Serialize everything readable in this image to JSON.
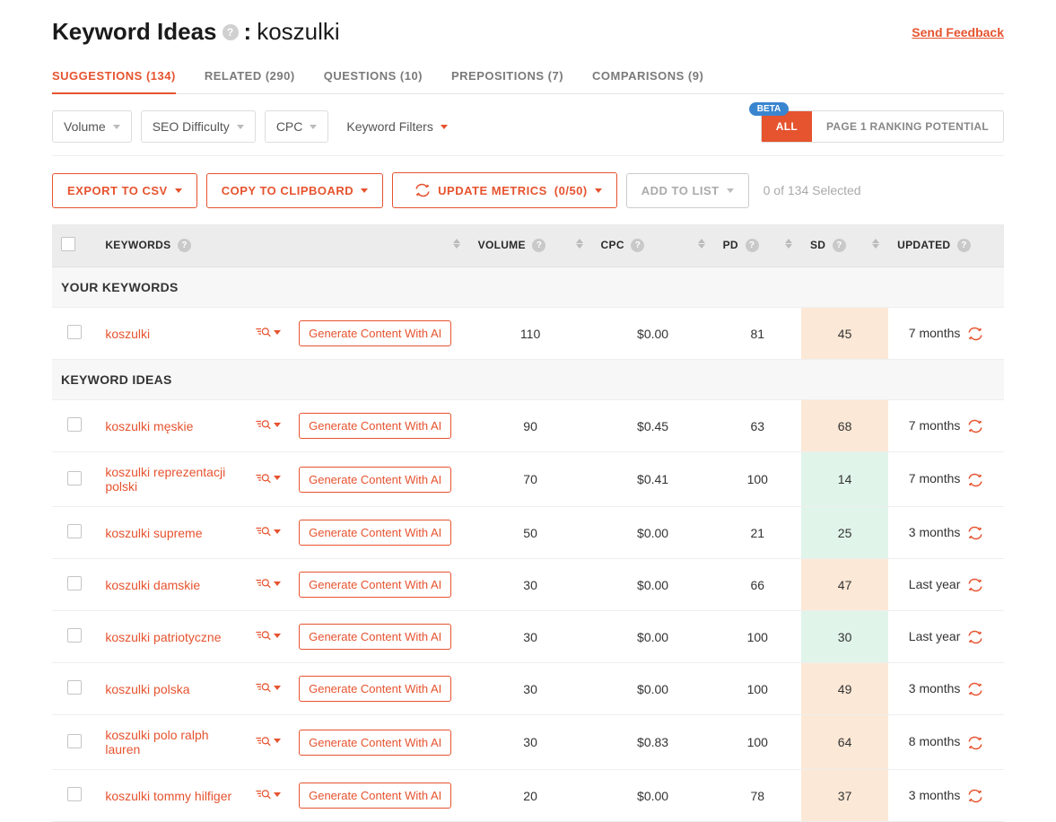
{
  "header": {
    "title_prefix": "Keyword Ideas",
    "title_sep": ":",
    "keyword": "koszulki",
    "feedback_label": "Send Feedback"
  },
  "tabs": [
    {
      "label": "SUGGESTIONS (134)",
      "active": true
    },
    {
      "label": "RELATED (290)",
      "active": false
    },
    {
      "label": "QUESTIONS (10)",
      "active": false
    },
    {
      "label": "PREPOSITIONS (7)",
      "active": false
    },
    {
      "label": "COMPARISONS (9)",
      "active": false
    }
  ],
  "filters": {
    "volume_label": "Volume",
    "seo_label": "SEO Difficulty",
    "cpc_label": "CPC",
    "kw_filters_label": "Keyword Filters",
    "beta_label": "BETA",
    "all_label": "ALL",
    "page1_label": "PAGE 1 RANKING POTENTIAL"
  },
  "actions": {
    "export_label": "EXPORT TO CSV",
    "copy_label": "COPY TO CLIPBOARD",
    "update_label": "UPDATE METRICS",
    "update_count": "(0/50)",
    "add_label": "ADD TO LIST",
    "selected_info": "0 of 134 Selected"
  },
  "columns": {
    "keywords": "KEYWORDS",
    "volume": "VOLUME",
    "cpc": "CPC",
    "pd": "PD",
    "sd": "SD",
    "updated": "UPDATED"
  },
  "sections": {
    "your_keywords": "YOUR KEYWORDS",
    "keyword_ideas": "KEYWORD IDEAS"
  },
  "gen_btn_label": "Generate Content With AI",
  "rows_main": [
    {
      "keyword": "koszulki",
      "volume": "110",
      "cpc": "$0.00",
      "pd": "81",
      "sd": "45",
      "sd_class": "sd-orange",
      "updated": "7 months"
    }
  ],
  "rows_ideas": [
    {
      "keyword": "koszulki męskie",
      "volume": "90",
      "cpc": "$0.45",
      "pd": "63",
      "sd": "68",
      "sd_class": "sd-orange",
      "updated": "7 months"
    },
    {
      "keyword": "koszulki reprezentacji polski",
      "volume": "70",
      "cpc": "$0.41",
      "pd": "100",
      "sd": "14",
      "sd_class": "sd-green",
      "updated": "7 months"
    },
    {
      "keyword": "koszulki supreme",
      "volume": "50",
      "cpc": "$0.00",
      "pd": "21",
      "sd": "25",
      "sd_class": "sd-green",
      "updated": "3 months"
    },
    {
      "keyword": "koszulki damskie",
      "volume": "30",
      "cpc": "$0.00",
      "pd": "66",
      "sd": "47",
      "sd_class": "sd-orange",
      "updated": "Last year"
    },
    {
      "keyword": "koszulki patriotyczne",
      "volume": "30",
      "cpc": "$0.00",
      "pd": "100",
      "sd": "30",
      "sd_class": "sd-green",
      "updated": "Last year"
    },
    {
      "keyword": "koszulki polska",
      "volume": "30",
      "cpc": "$0.00",
      "pd": "100",
      "sd": "49",
      "sd_class": "sd-orange",
      "updated": "3 months"
    },
    {
      "keyword": "koszulki polo ralph lauren",
      "volume": "30",
      "cpc": "$0.83",
      "pd": "100",
      "sd": "64",
      "sd_class": "sd-orange",
      "updated": "8 months"
    },
    {
      "keyword": "koszulki tommy hilfiger",
      "volume": "20",
      "cpc": "$0.00",
      "pd": "78",
      "sd": "37",
      "sd_class": "sd-orange",
      "updated": "3 months"
    }
  ]
}
